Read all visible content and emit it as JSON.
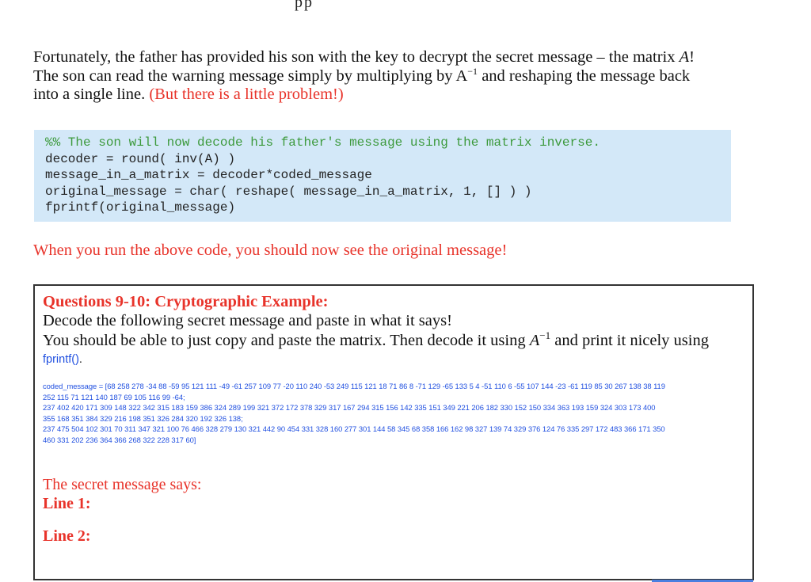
{
  "top_fragment": "pp",
  "intro": {
    "line1_a": "Fortunately, the father has provided his son with the key to decrypt the secret message – the matrix ",
    "line1_var": "A",
    "line1_end": "!",
    "line2_a": "The son can read the warning message simply by multiplying by A",
    "line2_sup": "−1",
    "line2_b": " and reshaping the message back",
    "line3_a": "into a single line. ",
    "line3_red": "(But there is a little problem!)"
  },
  "code": {
    "comment": "%% The son will now decode his father's message using the matrix inverse.",
    "lines": [
      "decoder = round( inv(A) )",
      "message_in_a_matrix = decoder*coded_message",
      "original_message = char( reshape( message_in_a_matrix, 1, [] ) )",
      "fprintf(original_message)"
    ]
  },
  "run_note": "When you run the above code, you should now see the original message!",
  "question": {
    "title": "Questions 9-10: Cryptographic Example:",
    "line1": "Decode the following secret message and paste in what it says!",
    "line2_a": "You should be able to just copy and paste the matrix. Then decode it using ",
    "line2_var": "A",
    "line2_sup": "−1",
    "line2_b": " and print it nicely using",
    "fprintf_label": "fprintf()",
    "fprintf_dot": ".",
    "coded_message_lines": [
      "coded_message = [68 258 278 -34 88 -59 95 121 111 -49 -61 257 109 77 -20 110 240 -53 249 115 121 18 71 86 8 -71 129 -65 133 5 4 -51 110 6 -55 107 144 -23 -61 119 85 30 267 138 38 119",
      "252 115 71 121 140 187 69 105 116 99 -64;",
      "237 402 420 171 309 148 322 342 315 183 159 386 324 289 199 321 372 172 378 329 317 167 294 315 156 142 335 151 349 221 206 182 330 152 150 334 363 193 159 324 303 173 400",
      "355 168 351 384 329 216 198 351 326 284 320 192 326 138;",
      "237 475 504 102 301 70 311 347 321 100 76 466 328 279 130 321 442 90 454 331 328 160 277 301 144 58 345 68 358 166 162 98 327 139 74 329 376 124 76 335 297 172 483 366 171 350",
      "460 331 202 236 364 366 268 322 228 317 60]"
    ],
    "secret_label": "The secret message says:",
    "line1_label": "Line 1:",
    "line2_label": "Line 2:"
  },
  "colors": {
    "accent_red": "#e8332a",
    "link_blue": "#1f4fe0",
    "code_bg": "#d3e8f8",
    "comment_green": "#3d9a3d"
  }
}
